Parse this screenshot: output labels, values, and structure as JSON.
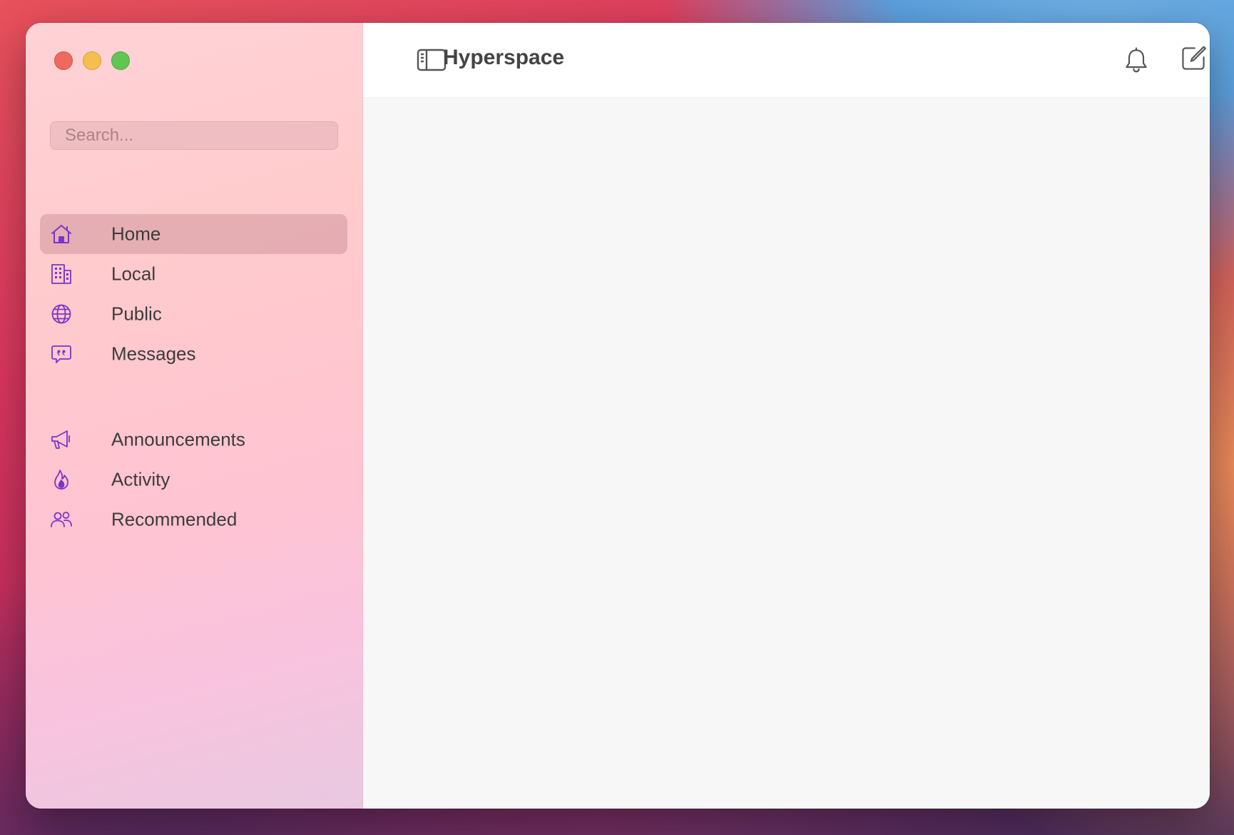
{
  "app": {
    "title": "Hyperspace"
  },
  "search": {
    "placeholder": "Search..."
  },
  "sidebar": {
    "accent_color": "#7b35c8",
    "primary_items": [
      {
        "label": "Home",
        "icon": "home-icon",
        "selected": true
      },
      {
        "label": "Local",
        "icon": "building-icon",
        "selected": false
      },
      {
        "label": "Public",
        "icon": "globe-icon",
        "selected": false
      },
      {
        "label": "Messages",
        "icon": "chat-bubble-icon",
        "selected": false
      }
    ],
    "secondary_items": [
      {
        "label": "Announcements",
        "icon": "megaphone-icon",
        "selected": false
      },
      {
        "label": "Activity",
        "icon": "flame-icon",
        "selected": false
      },
      {
        "label": "Recommended",
        "icon": "people-icon",
        "selected": false
      }
    ]
  },
  "toolbar": {
    "sidebar_toggle_icon": "sidebar-toggle-icon",
    "notifications_icon": "bell-icon",
    "compose_icon": "compose-icon"
  }
}
